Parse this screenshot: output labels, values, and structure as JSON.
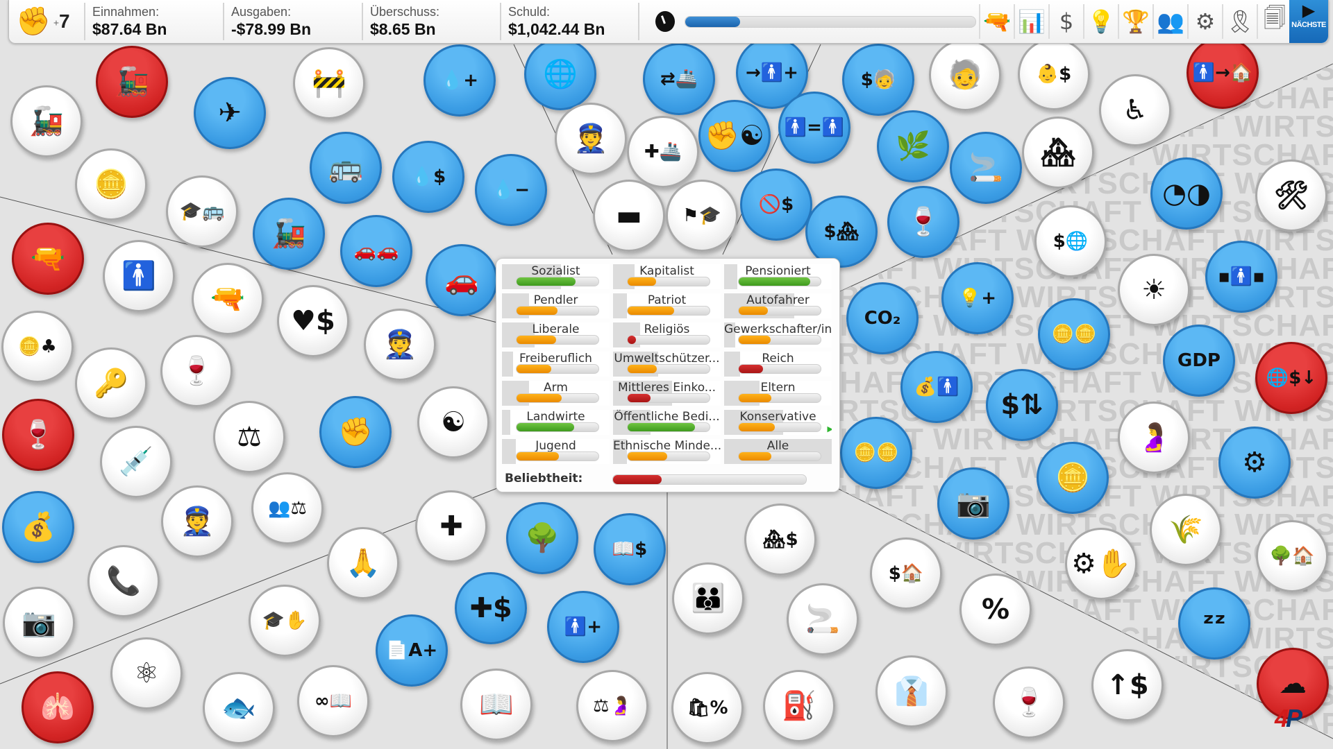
{
  "topbar": {
    "activism_icon": "raised-fist-icon",
    "activism_count": "7",
    "activism_prefix": "+",
    "stats": [
      {
        "label": "Einnahmen:",
        "value": "$87.64 Bn"
      },
      {
        "label": "Ausgaben:",
        "value": "-$78.99 Bn"
      },
      {
        "label": "Überschuss:",
        "value": "$8.65 Bn"
      },
      {
        "label": "Schuld:",
        "value": "$1,042.44 Bn"
      }
    ],
    "turn_progress_percent": 19,
    "tools": [
      {
        "name": "pistol-icon",
        "glyph": "🔫"
      },
      {
        "name": "bar-chart-icon",
        "glyph": "📊"
      },
      {
        "name": "dollar-icon",
        "glyph": "$"
      },
      {
        "name": "lightbulb-icon",
        "glyph": "💡"
      },
      {
        "name": "trophy-icon",
        "glyph": "🏆"
      },
      {
        "name": "people-group-icon",
        "glyph": "👥"
      },
      {
        "name": "gears-icon",
        "glyph": "⚙"
      },
      {
        "name": "award-ribbon-icon",
        "glyph": "🎗"
      },
      {
        "name": "documents-icon",
        "glyph": "🗐"
      }
    ],
    "next_label": "NÄCHSTE",
    "next_icon": "play-icon"
  },
  "watermark_text": "WIRTSCHAFT",
  "voter_groups": [
    {
      "name": "Sozialist",
      "popularity": 0.72,
      "color": "green",
      "share": 0.55
    },
    {
      "name": "Kapitalist",
      "popularity": 0.35,
      "color": "orange",
      "share": 0.2
    },
    {
      "name": "Pensioniert",
      "popularity": 0.87,
      "color": "green",
      "share": 0.12
    },
    {
      "name": "Pendler",
      "popularity": 0.5,
      "color": "orange",
      "share": 0.25
    },
    {
      "name": "Patriot",
      "popularity": 0.57,
      "color": "orange",
      "share": 0.13
    },
    {
      "name": "Autofahrer",
      "popularity": 0.36,
      "color": "orange",
      "share": 0.65
    },
    {
      "name": "Liberale",
      "popularity": 0.48,
      "color": "orange",
      "share": 0.3
    },
    {
      "name": "Religiös",
      "popularity": 0.07,
      "color": "red",
      "share": 0.25
    },
    {
      "name": "Gewerkschafter/in",
      "popularity": 0.39,
      "color": "orange",
      "share": 0.1
    },
    {
      "name": "Freiberuflich",
      "popularity": 0.42,
      "color": "orange",
      "share": 0.1
    },
    {
      "name": "Umweltschützer...",
      "popularity": 0.36,
      "color": "orange",
      "share": 0.42
    },
    {
      "name": "Reich",
      "popularity": 0.3,
      "color": "red",
      "share": 0.15
    },
    {
      "name": "Arm",
      "popularity": 0.55,
      "color": "orange",
      "share": 0.25
    },
    {
      "name": "Mittleres Einko...",
      "popularity": 0.28,
      "color": "red",
      "share": 0.55
    },
    {
      "name": "Eltern",
      "popularity": 0.4,
      "color": "orange",
      "share": 0.33
    },
    {
      "name": "Landwirte",
      "popularity": 0.7,
      "color": "green",
      "share": 0.08
    },
    {
      "name": "Öffentliche Bedi...",
      "popularity": 0.82,
      "color": "green",
      "share": 0.35,
      "trend": null
    },
    {
      "name": "Konservative",
      "popularity": 0.44,
      "color": "orange",
      "share": 0.55,
      "trend": "up"
    },
    {
      "name": "Jugend",
      "popularity": 0.52,
      "color": "orange",
      "share": 0.13
    },
    {
      "name": "Ethnische Minde...",
      "popularity": 0.48,
      "color": "orange",
      "share": 0.13
    },
    {
      "name": "Alle",
      "popularity": 0.4,
      "color": "orange",
      "share": 1.0
    }
  ],
  "popularity": {
    "label": "Beliebtheit:",
    "value": 0.25,
    "color": "red"
  },
  "policies": [
    {
      "icon": "steam-train-icon",
      "style": "white",
      "glyph": "🚂"
    },
    {
      "icon": "train-stop-sign-icon",
      "style": "red",
      "glyph": "🚂"
    },
    {
      "icon": "airplane-icon",
      "style": "blue",
      "glyph": "✈"
    },
    {
      "icon": "road-worker-icon",
      "style": "white",
      "glyph": "🚧"
    },
    {
      "icon": "oil-drop-plus-icon",
      "style": "blue",
      "glyph": "💧+"
    },
    {
      "icon": "globe-icon",
      "style": "blue",
      "glyph": "🌐"
    },
    {
      "icon": "cargo-ship-arrows-icon",
      "style": "blue",
      "glyph": "⇄🚢"
    },
    {
      "icon": "immigration-person-plus-icon",
      "style": "blue",
      "glyph": "→🚹+"
    },
    {
      "icon": "pension-elderly-dollar-icon",
      "style": "blue",
      "glyph": "$🧓"
    },
    {
      "icon": "elderly-person-icon",
      "style": "white",
      "glyph": "🧓"
    },
    {
      "icon": "baby-dollar-icon",
      "style": "white",
      "glyph": "👶$"
    },
    {
      "icon": "person-to-house-icon",
      "style": "red",
      "glyph": "🚹→🏠"
    },
    {
      "icon": "house-wheelchair-icon",
      "style": "white",
      "glyph": "♿"
    },
    {
      "icon": "road-toll-coin-icon",
      "style": "white",
      "glyph": "🪙"
    },
    {
      "icon": "school-bus-graduation-icon",
      "style": "white",
      "glyph": "🎓🚌"
    },
    {
      "icon": "bus-icon",
      "style": "blue",
      "glyph": "🚌"
    },
    {
      "icon": "oil-drop-dollar-icon",
      "style": "blue",
      "glyph": "💧$"
    },
    {
      "icon": "oil-drop-minus-icon",
      "style": "blue",
      "glyph": "💧−"
    },
    {
      "icon": "police-id-card-icon",
      "style": "white",
      "glyph": "👮"
    },
    {
      "icon": "hospital-ship-icon",
      "style": "white",
      "glyph": "✚🚢"
    },
    {
      "icon": "fist-yinyang-icon",
      "style": "blue",
      "glyph": "✊☯"
    },
    {
      "icon": "equality-icon",
      "style": "blue",
      "glyph": "🚹=🚹"
    },
    {
      "icon": "cannabis-leaf-icon",
      "style": "blue",
      "glyph": "🌿"
    },
    {
      "icon": "hand-cigarette-icon",
      "style": "blue",
      "glyph": "🚬"
    },
    {
      "icon": "houses-icon",
      "style": "white",
      "glyph": "🏘"
    },
    {
      "icon": "pie-charts-person-icon",
      "style": "blue",
      "glyph": "◔◑"
    },
    {
      "icon": "tools-icon",
      "style": "white",
      "glyph": "🛠"
    },
    {
      "icon": "tank-icon",
      "style": "white",
      "glyph": "▬"
    },
    {
      "icon": "flag-graduation-icon",
      "style": "white",
      "glyph": "⚑🎓"
    },
    {
      "icon": "no-dollar-icon",
      "style": "blue",
      "glyph": "🚫$"
    },
    {
      "icon": "dollar-houses-icon",
      "style": "blue",
      "glyph": "$🏘"
    },
    {
      "icon": "wine-bottle-glass-icon",
      "style": "blue",
      "glyph": "🍷"
    },
    {
      "icon": "dollar-globe-arrow-icon",
      "style": "white",
      "glyph": "$🌐"
    },
    {
      "icon": "steam-train-icon",
      "style": "blue",
      "glyph": "🚂"
    },
    {
      "icon": "cars-icon",
      "style": "blue",
      "glyph": "🚗🚗"
    },
    {
      "icon": "car-icon",
      "style": "blue",
      "glyph": "🚗"
    },
    {
      "icon": "rifle-hat-icon",
      "style": "red",
      "glyph": "🔫"
    },
    {
      "icon": "armed-guard-icon",
      "style": "white",
      "glyph": "🚹"
    },
    {
      "icon": "handgun-icon",
      "style": "white",
      "glyph": "🔫"
    },
    {
      "icon": "heart-dollar-icon",
      "style": "white",
      "glyph": "♥$"
    },
    {
      "icon": "police-officer-icon",
      "style": "white",
      "glyph": "👮"
    },
    {
      "icon": "gambling-coins-cards-icon",
      "style": "white",
      "glyph": "🪙♣"
    },
    {
      "icon": "prison-key-icon",
      "style": "white",
      "glyph": "🔑"
    },
    {
      "icon": "wine-glass-bottle-icon",
      "style": "white",
      "glyph": "🍷"
    },
    {
      "icon": "alcohol-icon",
      "style": "red",
      "glyph": "🍷"
    },
    {
      "icon": "syringe-icon",
      "style": "white",
      "glyph": "💉"
    },
    {
      "icon": "gavel-icon",
      "style": "white",
      "glyph": "⚖"
    },
    {
      "icon": "fist-icon",
      "style": "blue",
      "glyph": "✊"
    },
    {
      "icon": "yin-yang-icon",
      "style": "white",
      "glyph": "☯"
    },
    {
      "icon": "crowbar-loot-bag-icon",
      "style": "blue",
      "glyph": "💰"
    },
    {
      "icon": "security-guard-icon",
      "style": "white",
      "glyph": "👮"
    },
    {
      "icon": "jury-gavel-icon",
      "style": "white",
      "glyph": "👥⚖"
    },
    {
      "icon": "phone-thief-icon",
      "style": "white",
      "glyph": "📞"
    },
    {
      "icon": "camera-surveillance-people-icon",
      "style": "white",
      "glyph": "📷"
    },
    {
      "icon": "atom-icon",
      "style": "white",
      "glyph": "⚛"
    },
    {
      "icon": "lungs-health-icon",
      "style": "red",
      "glyph": "🫁"
    },
    {
      "icon": "fish-symbol-icon",
      "style": "white",
      "glyph": "🐟"
    },
    {
      "icon": "infinity-book-icon",
      "style": "white",
      "glyph": "∞📖"
    },
    {
      "icon": "praying-hands-book-icon",
      "style": "white",
      "glyph": "🙏"
    },
    {
      "icon": "graduation-hand-icon",
      "style": "white",
      "glyph": "🎓✋"
    },
    {
      "icon": "crowd-health-plus-icon",
      "style": "white",
      "glyph": "✚"
    },
    {
      "icon": "trees-park-icon",
      "style": "blue",
      "glyph": "🌳"
    },
    {
      "icon": "crowd-book-dollar-icon",
      "style": "blue",
      "glyph": "📖$"
    },
    {
      "icon": "crowd-health-dollar-icon",
      "style": "blue",
      "glyph": "✚$"
    },
    {
      "icon": "grade-a-plus-document-icon",
      "style": "blue",
      "glyph": "📄A+"
    },
    {
      "icon": "person-plus-icon",
      "style": "blue",
      "glyph": "🚹+"
    },
    {
      "icon": "crowd-book-icon",
      "style": "white",
      "glyph": "📖"
    },
    {
      "icon": "gavel-pregnant-icon",
      "style": "white",
      "glyph": "⚖🤰"
    },
    {
      "icon": "co2-icon",
      "style": "blue",
      "glyph": "CO₂"
    },
    {
      "icon": "lightbulb-plus-icon",
      "style": "blue",
      "glyph": "💡+"
    },
    {
      "icon": "coins-icon",
      "style": "blue",
      "glyph": "🪙🪙"
    },
    {
      "icon": "solar-wind-icon",
      "style": "white",
      "glyph": "☀"
    },
    {
      "icon": "person-network-icon",
      "style": "blue",
      "glyph": "▪🚹▪"
    },
    {
      "icon": "gdp-icon",
      "style": "blue",
      "glyph": "GDP"
    },
    {
      "icon": "globe-dollar-down-icon",
      "style": "red",
      "glyph": "🌐$↓"
    },
    {
      "icon": "money-bags-person-icon",
      "style": "blue",
      "glyph": "💰🚹"
    },
    {
      "icon": "dollar-up-down-icon",
      "style": "blue",
      "glyph": "$⇅"
    },
    {
      "icon": "coins-icon",
      "style": "blue",
      "glyph": "🪙🪙"
    },
    {
      "icon": "camera-icon",
      "style": "blue",
      "glyph": "📷"
    },
    {
      "icon": "coin-stacks-icon",
      "style": "blue",
      "glyph": "🪙"
    },
    {
      "icon": "pregnant-woman-icon",
      "style": "white",
      "glyph": "🤰"
    },
    {
      "icon": "monitor-gear-icon",
      "style": "blue",
      "glyph": "⚙"
    },
    {
      "icon": "houses-dollar-icon",
      "style": "white",
      "glyph": "🏘$"
    },
    {
      "icon": "hierarchy-icon",
      "style": "white",
      "glyph": "👪"
    },
    {
      "icon": "hand-cigarette-icon",
      "style": "white",
      "glyph": "🚬"
    },
    {
      "icon": "dollar-wind-house-icon",
      "style": "white",
      "glyph": "$🏠"
    },
    {
      "icon": "percent-icon",
      "style": "white",
      "glyph": "%"
    },
    {
      "icon": "gear-hand-icon",
      "style": "white",
      "glyph": "⚙✋"
    },
    {
      "icon": "wheat-icon",
      "style": "white",
      "glyph": "🌾"
    },
    {
      "icon": "tree-house-hand-icon",
      "style": "white",
      "glyph": "🌳🏠"
    },
    {
      "icon": "sleeping-person-icon",
      "style": "blue",
      "glyph": "ᶻᶻ"
    },
    {
      "icon": "shopping-bag-percent-icon",
      "style": "white",
      "glyph": "🛍%"
    },
    {
      "icon": "fuel-pump-icon",
      "style": "white",
      "glyph": "⛽"
    },
    {
      "icon": "businessman-icon",
      "style": "white",
      "glyph": "👔"
    },
    {
      "icon": "wine-glass-bottle-icon",
      "style": "white",
      "glyph": "🍷"
    },
    {
      "icon": "coins-up-dollar-icon",
      "style": "white",
      "glyph": "↑$"
    },
    {
      "icon": "cloud-icon",
      "style": "red",
      "glyph": "☁"
    }
  ],
  "logo": {
    "part1": "4",
    "part2": "P"
  }
}
